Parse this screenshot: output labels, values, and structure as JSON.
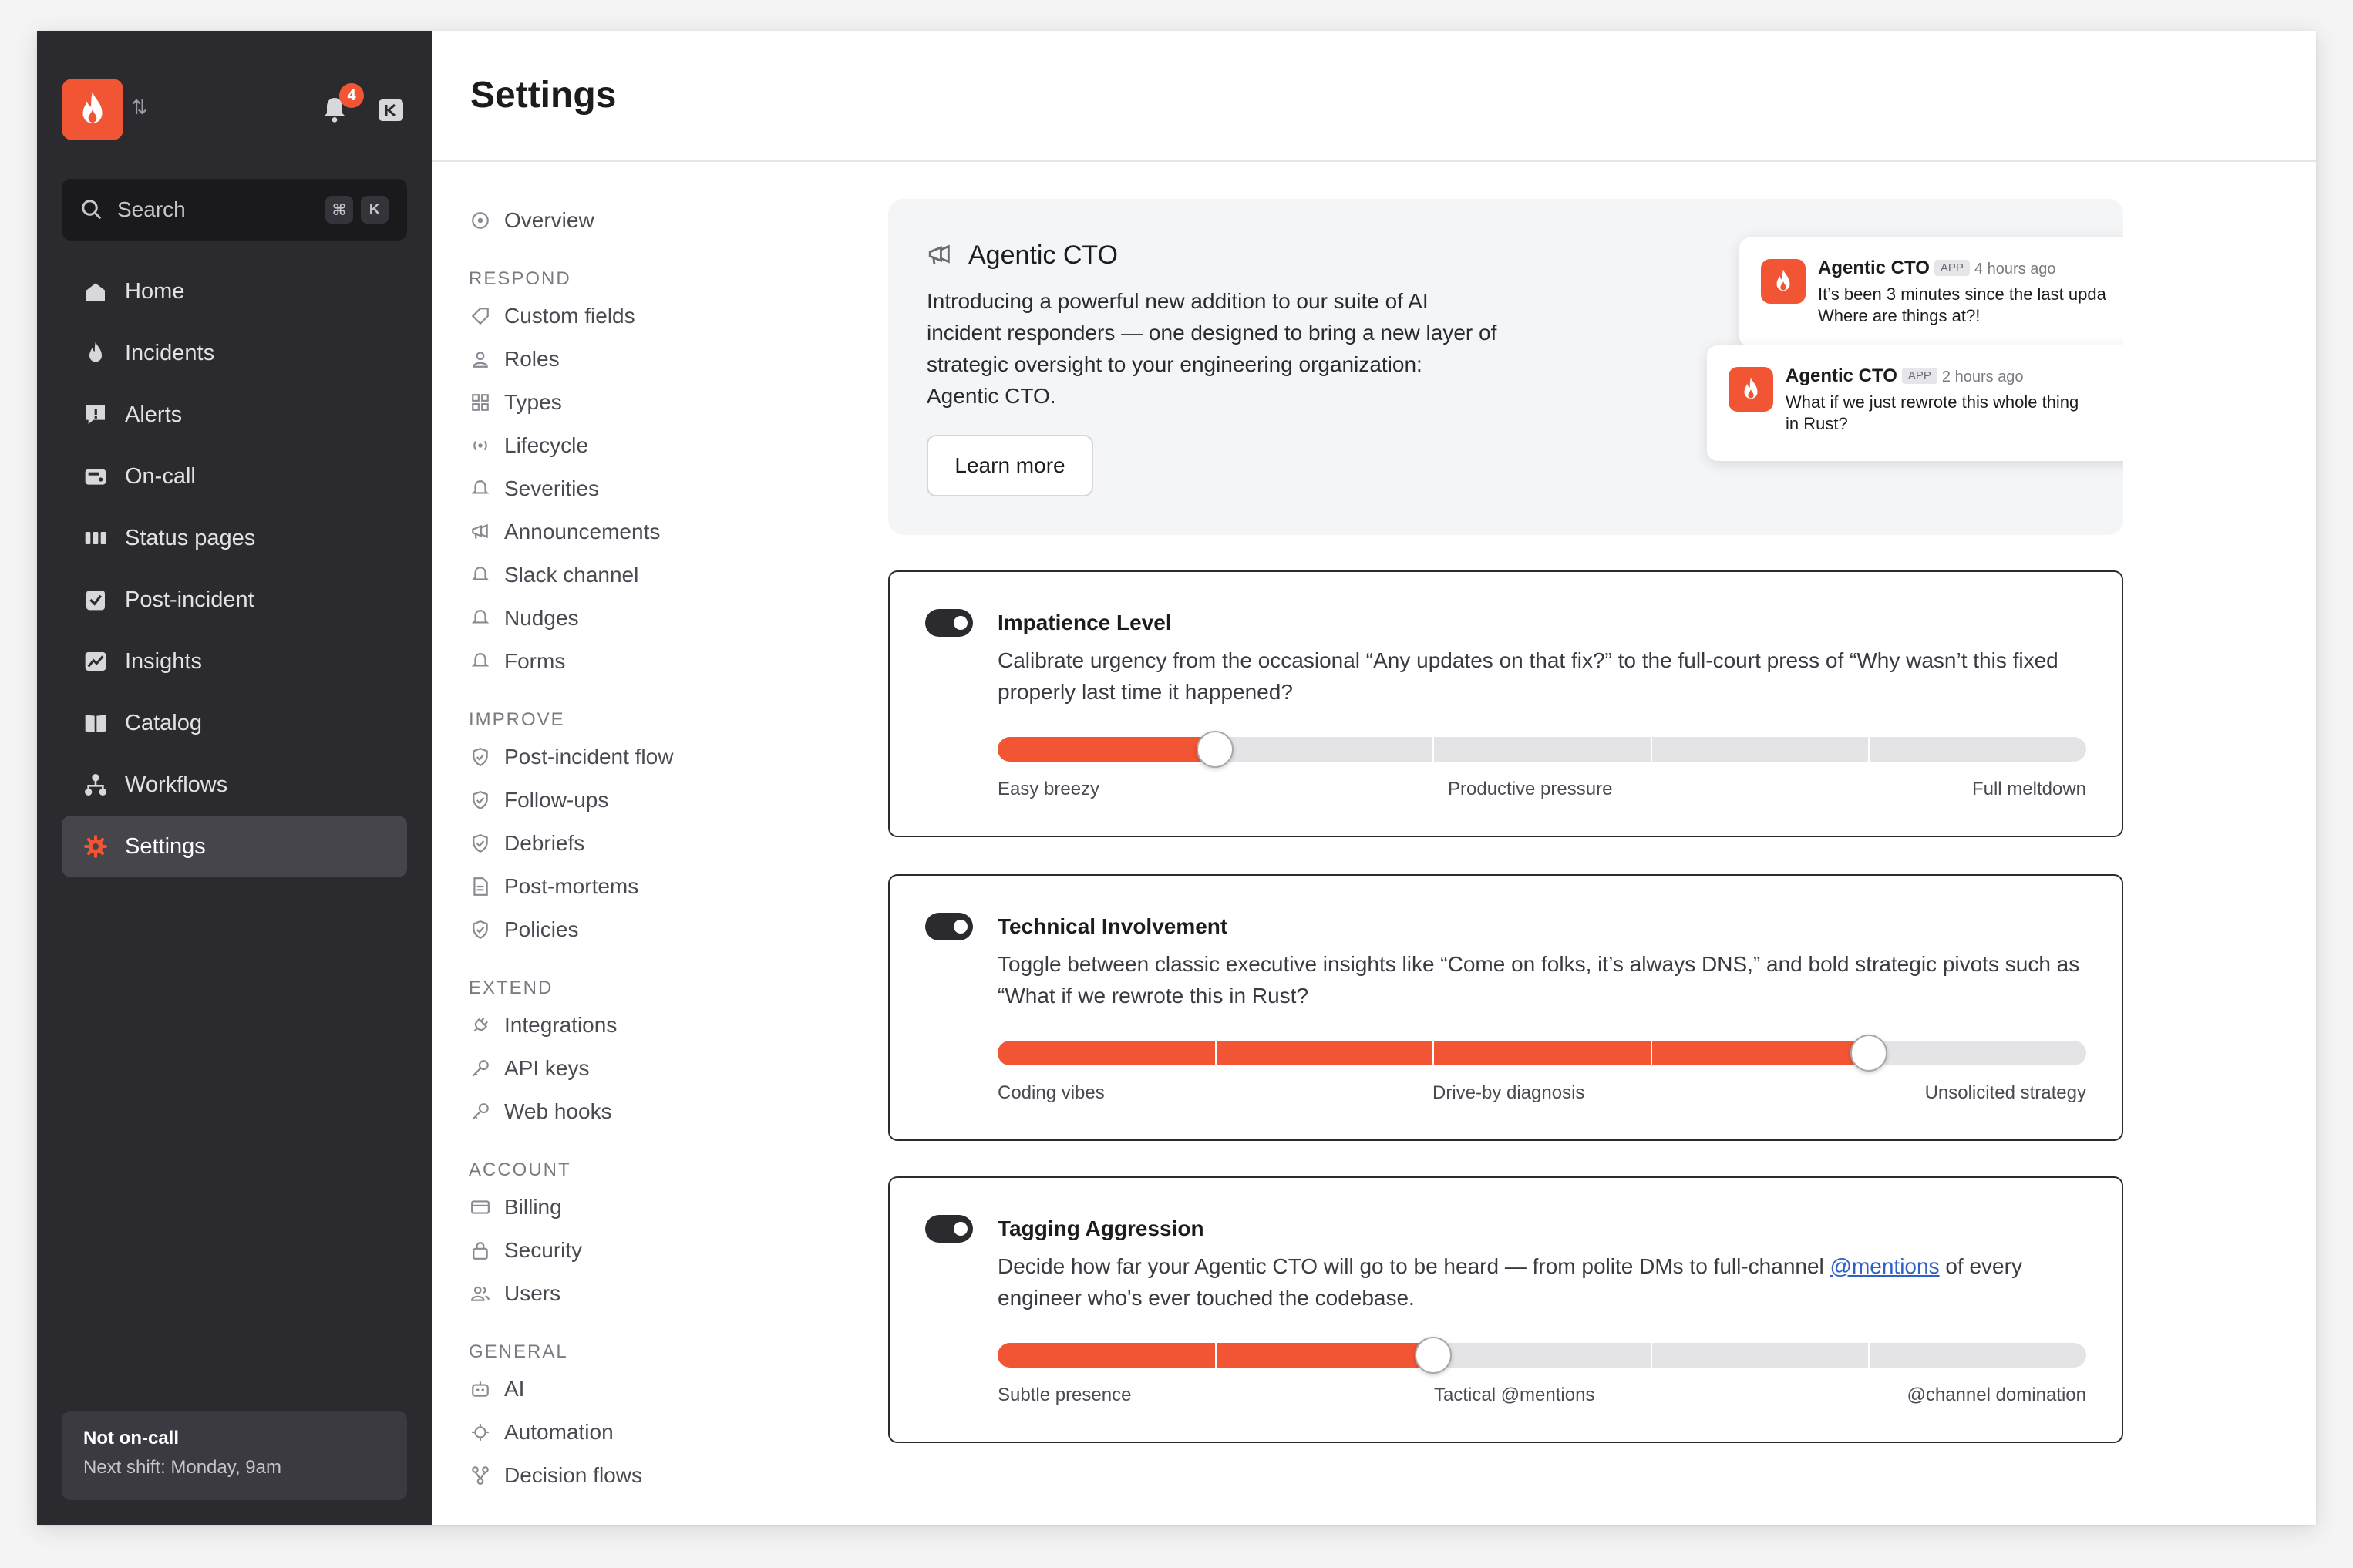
{
  "sidebar": {
    "notification_count": "4",
    "search_label": "Search",
    "search_shortcut": [
      "⌘",
      "K"
    ],
    "items": [
      {
        "label": "Home",
        "icon": "home-icon"
      },
      {
        "label": "Incidents",
        "icon": "flame-icon"
      },
      {
        "label": "Alerts",
        "icon": "alert-icon"
      },
      {
        "label": "On-call",
        "icon": "pager-icon"
      },
      {
        "label": "Status pages",
        "icon": "status-bars-icon"
      },
      {
        "label": "Post-incident",
        "icon": "checklist-icon"
      },
      {
        "label": "Insights",
        "icon": "chart-icon"
      },
      {
        "label": "Catalog",
        "icon": "book-icon"
      },
      {
        "label": "Workflows",
        "icon": "workflow-icon"
      },
      {
        "label": "Settings",
        "icon": "gear-icon",
        "active": true
      }
    ],
    "oncall": {
      "title": "Not on-call",
      "subtitle": "Next shift: Monday, 9am"
    }
  },
  "header": {
    "title": "Settings"
  },
  "settings_nav": {
    "overview": "Overview",
    "sections": [
      {
        "heading": "RESPOND",
        "items": [
          "Custom fields",
          "Roles",
          "Types",
          "Lifecycle",
          "Severities",
          "Announcements",
          "Slack channel",
          "Nudges",
          "Forms"
        ]
      },
      {
        "heading": "IMPROVE",
        "items": [
          "Post-incident flow",
          "Follow-ups",
          "Debriefs",
          "Post-mortems",
          "Policies"
        ]
      },
      {
        "heading": "EXTEND",
        "items": [
          "Integrations",
          "API keys",
          "Web hooks"
        ]
      },
      {
        "heading": "ACCOUNT",
        "items": [
          "Billing",
          "Security",
          "Users"
        ]
      },
      {
        "heading": "GENERAL",
        "items": [
          "AI",
          "Automation",
          "Decision flows"
        ]
      }
    ]
  },
  "promo": {
    "title": "Agentic CTO",
    "body": "Introducing a powerful new addition to our suite of AI incident responders — one designed to bring a new layer of strategic oversight to your engineering organization: Agentic CTO.",
    "button": "Learn more",
    "messages": [
      {
        "name": "Agentic CTO",
        "tag": "APP",
        "time": "4 hours ago",
        "text": "It’s been 3 minutes since the last upda\nWhere are things at?!"
      },
      {
        "name": "Agentic CTO",
        "tag": "APP",
        "time": "2 hours ago",
        "text": "What if we just rewrote this whole thing\nin Rust?"
      }
    ]
  },
  "cards": [
    {
      "title": "Impatience Level",
      "description": "Calibrate urgency from the occasional “Any updates on that fix?” to the full-court press of “Why wasn’t this fixed properly last time it happened?",
      "enabled": true,
      "level": 0.2,
      "labels": [
        "Easy breezy",
        "Productive pressure",
        "Full meltdown"
      ]
    },
    {
      "title": "Technical Involvement",
      "description": "Toggle between classic executive insights like “Come on folks, it’s always DNS,” and bold strategic pivots such as “What if we rewrote this in Rust?",
      "enabled": true,
      "level": 0.8,
      "labels": [
        "Coding vibes",
        "Drive-by diagnosis",
        "Unsolicited strategy"
      ]
    },
    {
      "title": "Tagging Aggression",
      "description_before": "Decide how far your Agentic CTO will go to be heard — from polite DMs to full-channel ",
      "description_link": "@mentions",
      "description_after": " of every engineer who's ever touched the codebase.",
      "enabled": true,
      "level": 0.4,
      "labels": [
        "Subtle presence",
        "Tactical @mentions",
        "@channel domination"
      ]
    }
  ],
  "colors": {
    "accent": "#f25533",
    "sidebar": "#2b2b2f",
    "link": "#2f5fc8"
  }
}
